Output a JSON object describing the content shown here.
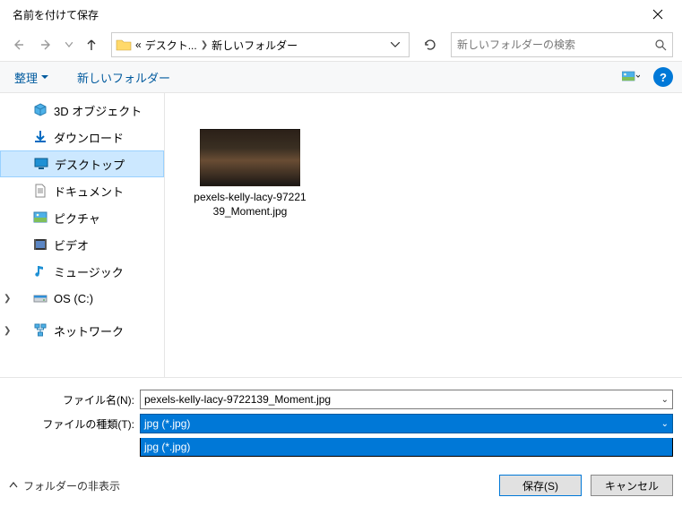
{
  "window": {
    "title": "名前を付けて保存"
  },
  "breadcrumbs": {
    "root_prefix": "«",
    "part1": "デスクト...",
    "part2": "新しいフォルダー"
  },
  "search": {
    "placeholder": "新しいフォルダーの検索"
  },
  "toolbar": {
    "organize": "整理",
    "newfolder": "新しいフォルダー"
  },
  "sidebar": {
    "items": [
      {
        "label": "3D オブジェクト",
        "icon": "cube-3d",
        "expand": true
      },
      {
        "label": "ダウンロード",
        "icon": "download"
      },
      {
        "label": "デスクトップ",
        "icon": "desktop",
        "selected": true
      },
      {
        "label": "ドキュメント",
        "icon": "document"
      },
      {
        "label": "ピクチャ",
        "icon": "pictures"
      },
      {
        "label": "ビデオ",
        "icon": "video"
      },
      {
        "label": "ミュージック",
        "icon": "music"
      },
      {
        "label": "OS (C:)",
        "icon": "drive",
        "expand": true
      },
      {
        "label": "ネットワーク",
        "icon": "network",
        "root": true,
        "expand": true
      }
    ]
  },
  "file": {
    "thumbnail_name": "pexels-kelly-lacy-9722139_Moment.jpg"
  },
  "fields": {
    "filename_label": "ファイル名(N):",
    "filename_value": "pexels-kelly-lacy-9722139_Moment.jpg",
    "filetype_label": "ファイルの種類(T):",
    "filetype_value": "jpg (*.jpg)",
    "filetype_options": [
      "jpg (*.jpg)"
    ]
  },
  "footer": {
    "hidefolders": "フォルダーの非表示",
    "save": "保存(S)",
    "cancel": "キャンセル"
  }
}
